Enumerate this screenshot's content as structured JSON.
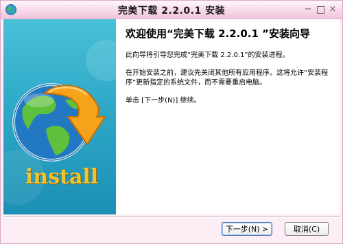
{
  "window": {
    "title": "完美下载 2.2.0.1 安装",
    "icons": {
      "app": "installer-globe-icon",
      "minimize": "minimize-icon",
      "maximize": "maximize-icon",
      "close": "close-icon"
    },
    "controls": {
      "minimize": "−",
      "close": "×"
    }
  },
  "side_panel": {
    "image": "globe-with-download-arrow",
    "install_label": "install"
  },
  "main": {
    "welcome_title": "欢迎使用“完美下载 2.2.0.1 ”安装向导",
    "para1": "此向导将引导您完成“完美下载 2.2.0.1”的安装进程。",
    "para2": "在开始安装之前，建议先关闭其他所有应用程序。这将允许“安装程序”更新指定的系统文件，而不需要重启电脑。",
    "para3": "单击 [下一步(N)] 继续。"
  },
  "buttons": {
    "next": "下一步(N) >",
    "cancel": "取消(C)"
  },
  "colors": {
    "window_tint": "#fdeef6",
    "panel_top": "#49c0d8",
    "panel_bottom": "#1b8fb4",
    "arrow": "#f7a21b",
    "install_text": "#f2c230"
  }
}
